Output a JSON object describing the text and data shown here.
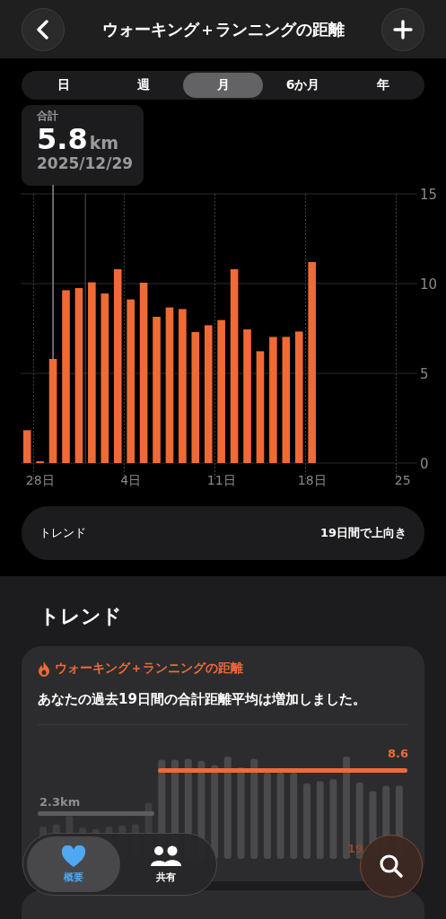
{
  "header": {
    "title": "ウォーキング＋ランニングの距離"
  },
  "range_tabs": [
    {
      "label": "日",
      "selected": false
    },
    {
      "label": "週",
      "selected": false
    },
    {
      "label": "月",
      "selected": true
    },
    {
      "label": "6か月",
      "selected": false
    },
    {
      "label": "年",
      "selected": false
    }
  ],
  "summary": {
    "label": "合計",
    "value": "5.8",
    "unit": "km",
    "date": "2025/12/29"
  },
  "chart": {
    "chart_data": {
      "type": "bar",
      "categories": [
        null,
        "28日",
        null,
        null,
        null,
        null,
        null,
        null,
        "4日",
        null,
        null,
        null,
        null,
        null,
        null,
        "11日",
        null,
        null,
        null,
        null,
        null,
        null,
        "18日",
        null,
        null,
        null,
        null,
        null,
        null,
        "25"
      ],
      "series": [
        {
          "color": "#f06a35",
          "values": [
            1.83,
            0.08,
            5.8,
            9.63,
            9.75,
            10.07,
            9.45,
            10.8,
            9.12,
            10.05,
            8.15,
            8.67,
            8.58,
            7.3,
            7.68,
            7.97,
            10.8,
            7.45,
            6.23,
            7.03,
            7.03,
            7.33,
            11.2,
            null,
            null,
            null,
            null,
            null,
            null,
            null
          ]
        }
      ],
      "ylim": [
        0,
        15
      ],
      "yticks": [
        0,
        5,
        10,
        15
      ],
      "grid": true
    }
  },
  "trend_row": {
    "label": "トレンド",
    "value": "19日間で上向き"
  },
  "section_title": "トレンド",
  "trend_card": {
    "category": "ウォーキング＋ランニングの距離",
    "message": "あなたの過去19日間の合計距離平均は増加しました。",
    "previous_average": "2.3km",
    "current_average": "8.6",
    "period_label": "19"
  },
  "tab_bar": [
    {
      "label": "概要",
      "selected": true
    },
    {
      "label": "共有",
      "selected": false
    }
  ]
}
